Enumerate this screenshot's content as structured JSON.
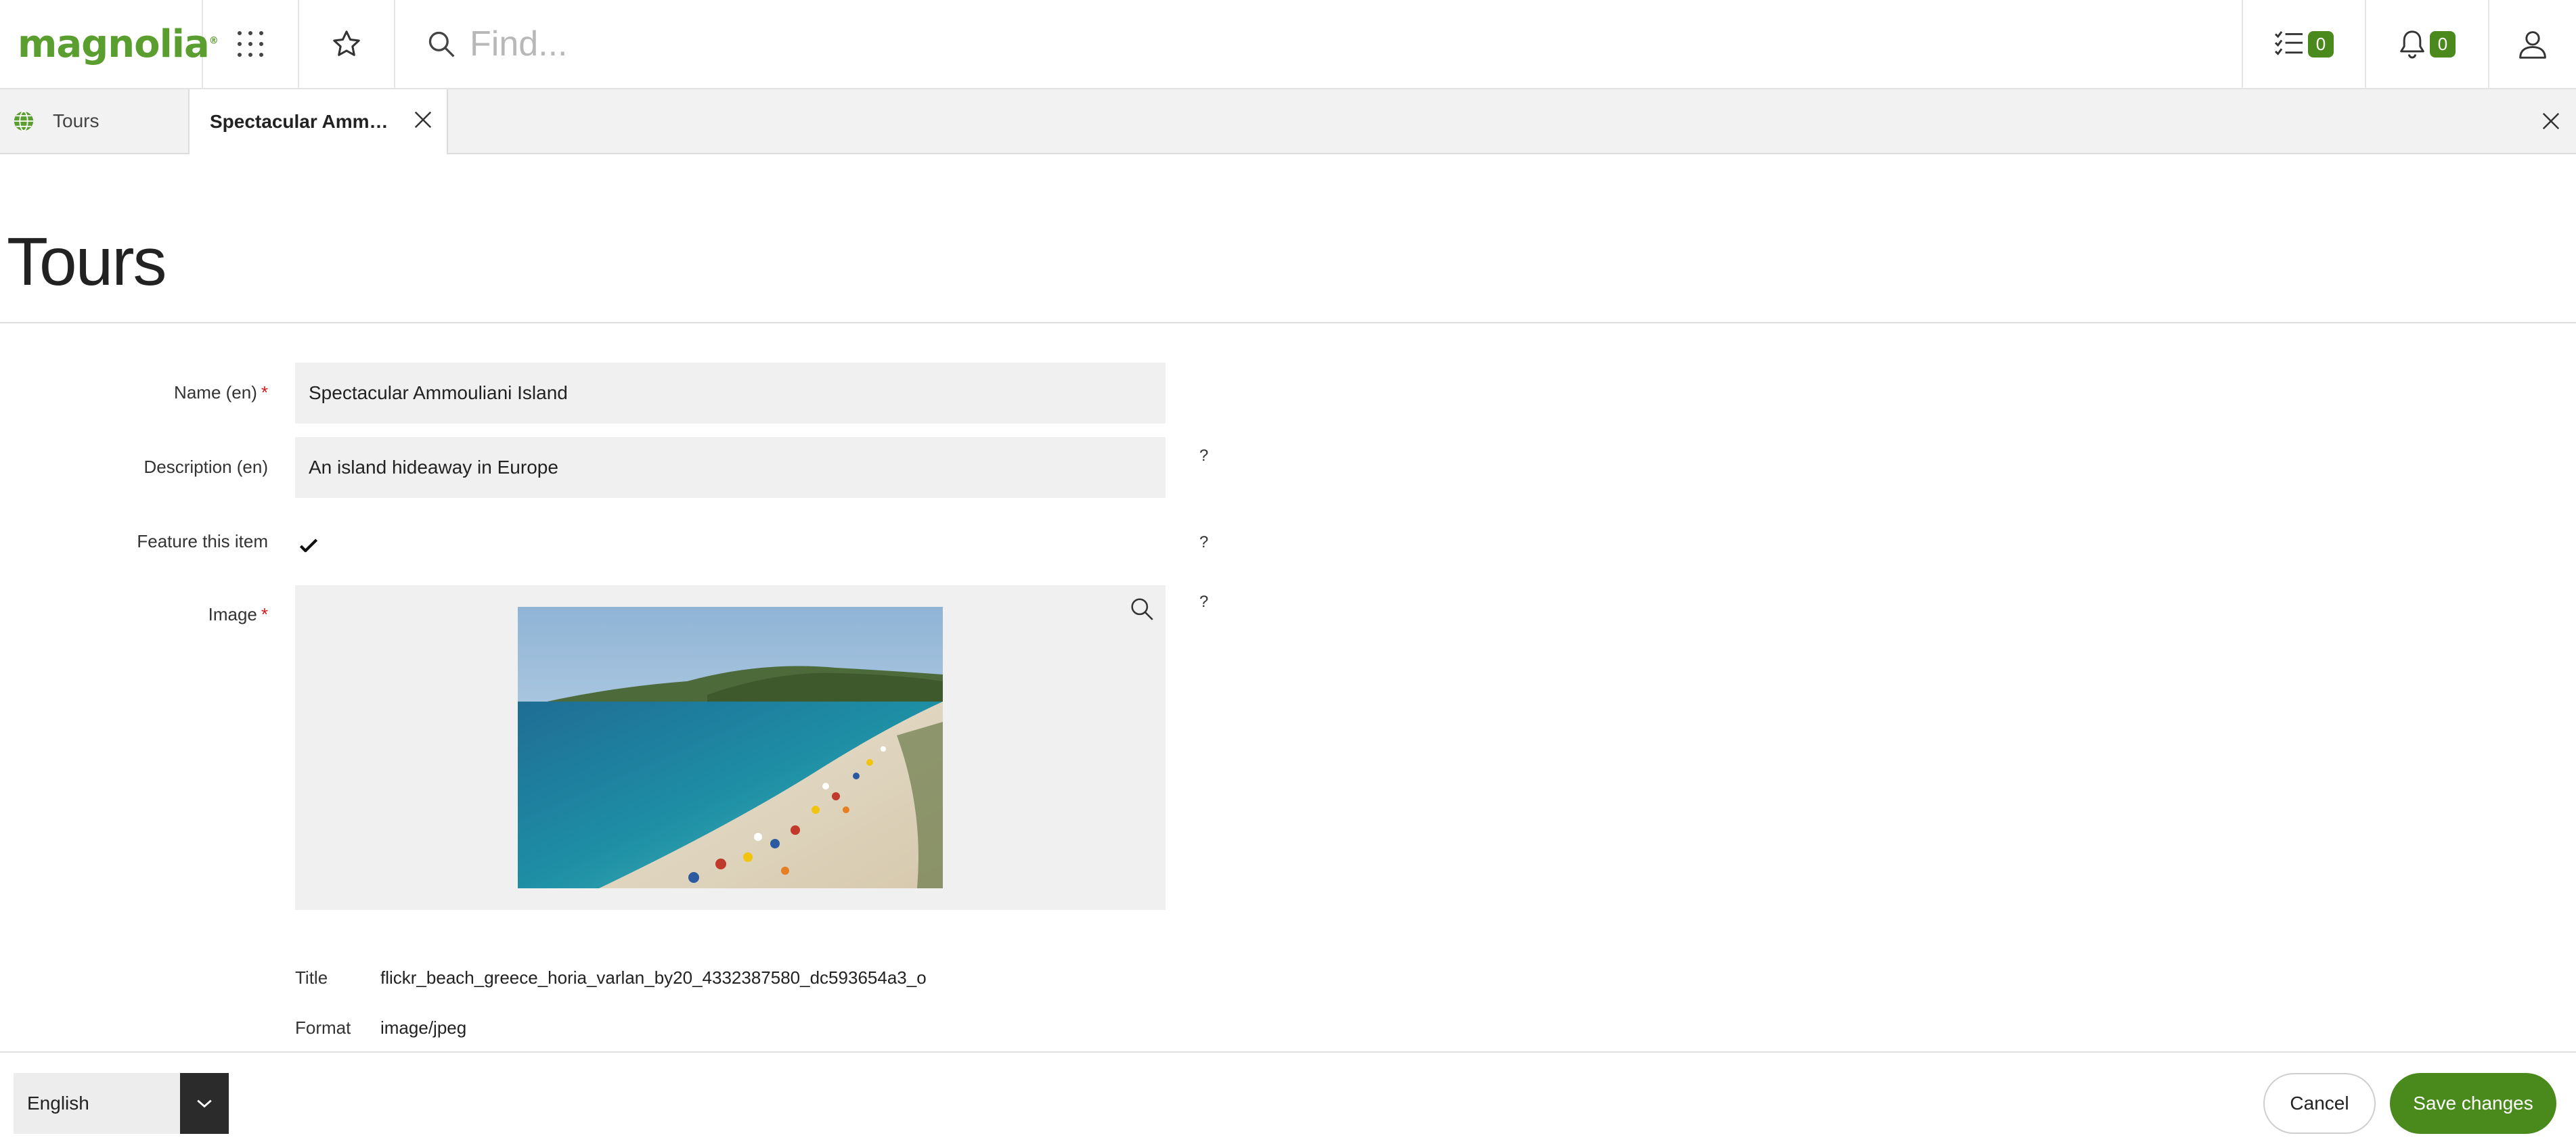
{
  "app": {
    "logo_text": "magnolia",
    "logo_mark": "®",
    "brand_color": "#5a9e2f",
    "accent_color": "#4a8a1d"
  },
  "topbar": {
    "search_placeholder": "Find...",
    "tasks_count": "0",
    "notifications_count": "0",
    "icons": [
      "apps-grid-icon",
      "star-icon",
      "search-icon",
      "tasks-icon",
      "bell-icon",
      "user-icon"
    ]
  },
  "tabs": [
    {
      "label": "Tours",
      "icon": "globe-icon"
    },
    {
      "label": "Spectacular Ammou...",
      "active": true
    }
  ],
  "page": {
    "title": "Tours"
  },
  "form": {
    "name_label": "Name (en)",
    "name_value": "Spectacular Ammouliani Island",
    "description_label": "Description (en)",
    "description_value": "An island hideaway in Europe",
    "feature_label": "Feature this item",
    "feature_checked": true,
    "image_label": "Image",
    "required_marker": "*",
    "help_marker": "?",
    "image_meta": {
      "title_key": "Title",
      "title_value": "flickr_beach_greece_horia_varlan_by20_4332387580_dc593654a3_o",
      "format_key": "Format",
      "format_value": "image/jpeg"
    }
  },
  "footer": {
    "language_value": "English",
    "cancel_label": "Cancel",
    "save_label": "Save changes"
  }
}
